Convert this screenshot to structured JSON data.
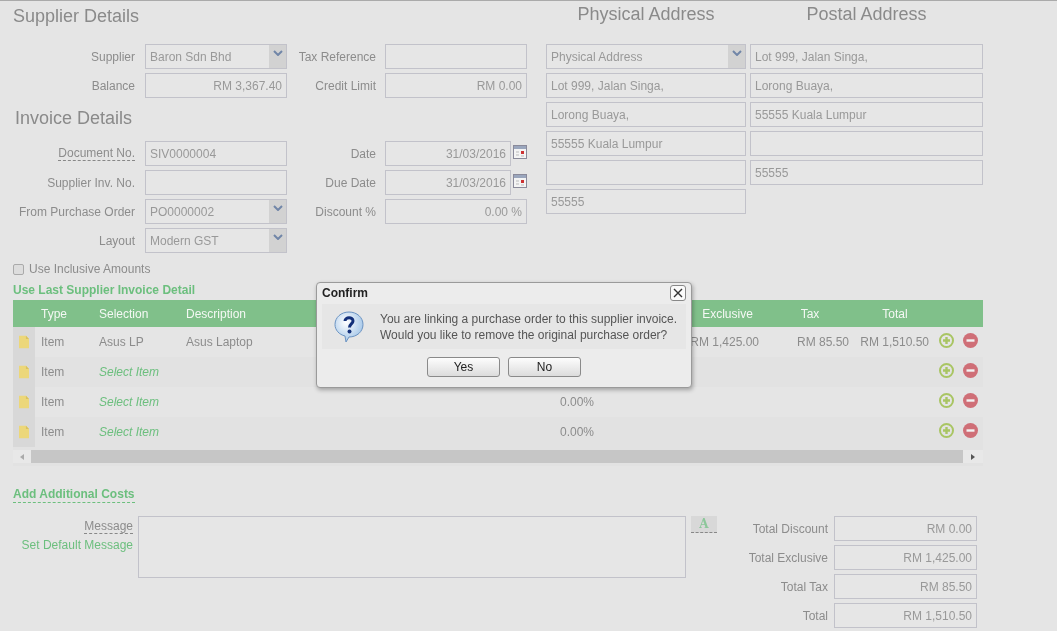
{
  "supplier_details": {
    "title": "Supplier Details",
    "fields": [
      {
        "label": "Supplier",
        "kind": "select",
        "value": "Baron Sdn Bhd",
        "hint": false
      },
      {
        "label": "Tax Reference",
        "kind": "text",
        "hint": false
      },
      {
        "label": "Balance",
        "kind": "amount",
        "value": "RM 3,367.40",
        "hint": false
      },
      {
        "label": "Credit Limit",
        "kind": "amount",
        "value": "RM 0.00",
        "hint": false
      }
    ]
  },
  "invoice_details": {
    "title": "Invoice Details",
    "fields": [
      {
        "label": "Document No.",
        "kind": "text",
        "value": "SIV0000004",
        "hint": true
      },
      {
        "label": "Date",
        "kind": "date",
        "value": "31/03/2016",
        "hint": false
      },
      {
        "label": "Supplier Inv. No.",
        "kind": "text",
        "hint": false
      },
      {
        "label": "Due Date",
        "kind": "date",
        "value": "31/03/2016",
        "hint": false
      },
      {
        "label": "From Purchase Order",
        "kind": "select",
        "value": "PO0000002",
        "hint": false
      },
      {
        "label": "Discount %",
        "kind": "amount",
        "value": "0.00 %",
        "hint": false
      },
      {
        "label": "Layout",
        "kind": "select",
        "value": "Modern GST",
        "hint": false
      }
    ]
  },
  "addresses": [
    {
      "title": "Physical Address",
      "lines": [
        {
          "kind": "select",
          "value": "Physical Address"
        },
        {
          "kind": "text",
          "value": "Lot 999, Jalan Singa,"
        },
        {
          "kind": "text",
          "value": "Lorong Buaya,"
        },
        {
          "kind": "text",
          "value": "55555 Kuala Lumpur"
        },
        {
          "kind": "text"
        },
        {
          "kind": "text",
          "value": "55555"
        }
      ]
    },
    {
      "title": "Postal Address",
      "lines": [
        {
          "kind": "text",
          "value": "Lot 999, Jalan Singa,"
        },
        {
          "kind": "text",
          "value": "Lorong Buaya,"
        },
        {
          "kind": "text",
          "value": "55555 Kuala Lumpur"
        },
        {
          "kind": "text"
        },
        {
          "kind": "text",
          "value": "55555"
        }
      ]
    }
  ],
  "use_inclusive_amounts": {
    "label": "Use Inclusive Amounts",
    "checked": false
  },
  "use_last_link": "Use Last Supplier Invoice Detail",
  "line_items": {
    "columns": [
      {
        "label": "Type"
      },
      {
        "label": "Selection"
      },
      {
        "label": "Description"
      },
      {
        "label": "Exclusive"
      },
      {
        "label": "Tax"
      },
      {
        "label": "Total"
      }
    ],
    "rows": [
      {
        "type": "Item",
        "selection": "Asus LP",
        "placeholder": false,
        "description": "Asus Laptop",
        "exclusive": "RM 1,425.00",
        "tax": "RM 85.50",
        "total": "RM 1,510.50"
      },
      {
        "type": "Item",
        "selection": "Select Item",
        "placeholder": true
      },
      {
        "type": "Item",
        "selection": "Select Item",
        "placeholder": true,
        "column_5": "0.00%"
      },
      {
        "type": "Item",
        "selection": "Select Item",
        "placeholder": true,
        "column_5": "0.00%"
      }
    ]
  },
  "add_costs_link": "Add Additional Costs",
  "message": {
    "label": "Message",
    "link": "Set Default Message",
    "format_button": "A"
  },
  "totals": [
    {
      "label": "Total Discount",
      "value": "RM 0.00"
    },
    {
      "label": "Total Exclusive",
      "value": "RM 1,425.00"
    },
    {
      "label": "Total Tax",
      "value": "RM 85.50"
    },
    {
      "label": "Total",
      "value": "RM 1,510.50"
    }
  ],
  "dialog": {
    "title": "Confirm",
    "message": "You are linking a purchase order to this supplier invoice.\nWould you like to remove the original purchase order?",
    "buttons": [
      "Yes",
      "No"
    ]
  }
}
